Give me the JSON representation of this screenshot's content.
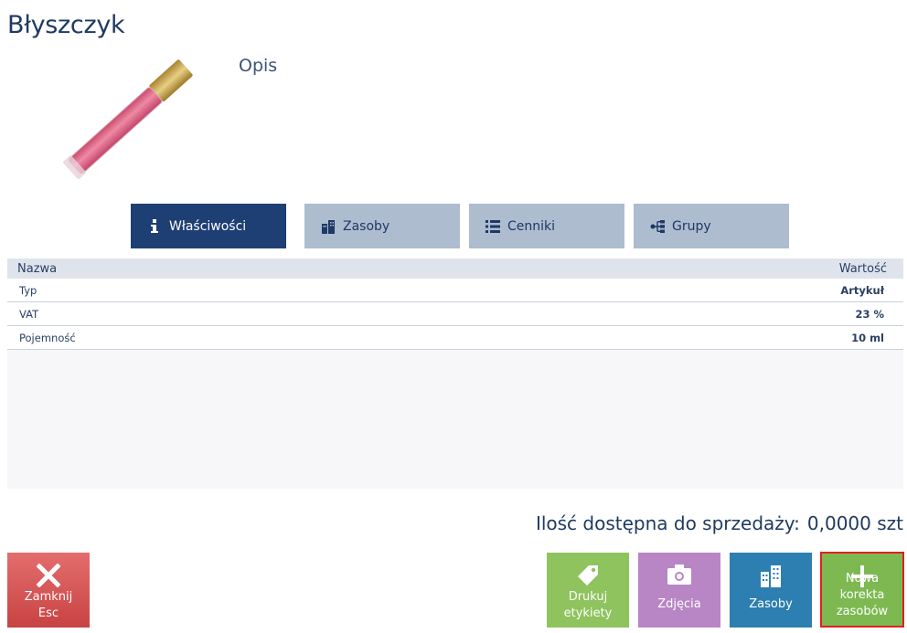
{
  "product": {
    "title": "Błyszczyk",
    "description_label": "Opis"
  },
  "tabs": [
    {
      "label": "Właściwości",
      "icon": "info-icon",
      "active": true
    },
    {
      "label": "Zasoby",
      "icon": "buildings-icon",
      "active": false
    },
    {
      "label": "Cenniki",
      "icon": "list-icon",
      "active": false
    },
    {
      "label": "Grupy",
      "icon": "hierarchy-icon",
      "active": false
    }
  ],
  "properties": {
    "headers": {
      "name": "Nazwa",
      "value": "Wartość"
    },
    "rows": [
      {
        "name": "Typ",
        "value": "Artykuł"
      },
      {
        "name": "VAT",
        "value": "23 %"
      },
      {
        "name": "Pojemność",
        "value": "10 ml"
      }
    ]
  },
  "availability": {
    "label": "Ilość dostępna do sprzedaży:",
    "value": "0,0000 szt"
  },
  "buttons": {
    "close": {
      "line1": "Zamknij",
      "line2": "Esc",
      "icon": "close-icon",
      "color": "#d95757"
    },
    "print_labels": {
      "line1": "Drukuj",
      "line2": "etykiety",
      "icon": "tag-icon",
      "color": "#8fc35d"
    },
    "photos": {
      "line1": "Zdjęcia",
      "icon": "camera-icon",
      "color": "#b886c4"
    },
    "stock": {
      "line1": "Zasoby",
      "icon": "buildings-icon",
      "color": "#2c7fb0"
    },
    "new_correction": {
      "line1": "Nowa korekta",
      "line2": "zasobów",
      "icon": "plus-icon",
      "color": "#7db950"
    }
  }
}
